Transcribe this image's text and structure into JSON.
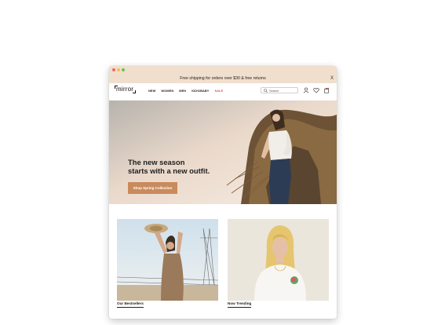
{
  "window": {
    "controls": [
      "close",
      "minimize",
      "zoom"
    ]
  },
  "promo": {
    "text": "Free shipping  for orders over $30 & free returns",
    "close_label": "X"
  },
  "brand": {
    "logo_text": "mirror"
  },
  "nav": {
    "items": [
      {
        "label": "NEW"
      },
      {
        "label": "WOMEN"
      },
      {
        "label": "MEN"
      },
      {
        "label": "KIDS/BABY"
      },
      {
        "label": "SALE"
      }
    ]
  },
  "search": {
    "placeholder": "Search"
  },
  "header_icons": [
    "user-icon",
    "heart-icon",
    "bag-icon"
  ],
  "hero": {
    "headline_line1": "The new season",
    "headline_line2": "starts with a new outfit.",
    "cta_label": "Shop Spring Collection"
  },
  "cards": [
    {
      "label": "Our Bestsellers"
    },
    {
      "label": "Now Trending"
    }
  ],
  "colors": {
    "promo_bg": "#f1dfcd",
    "cta_bg": "#c98a5c",
    "sale": "#d9534f",
    "text": "#222222"
  }
}
